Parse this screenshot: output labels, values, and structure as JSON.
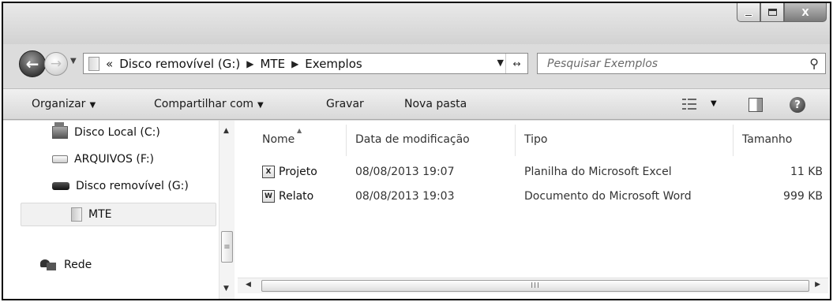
{
  "window": {
    "caption_buttons": {
      "minimize": "",
      "maximize": "",
      "close": "X"
    }
  },
  "address": {
    "chevrons": "«",
    "breadcrumbs": [
      "Disco removível (G:)",
      "MTE",
      "Exemplos"
    ],
    "separator": "▶"
  },
  "search": {
    "placeholder": "Pesquisar Exemplos"
  },
  "toolbar": {
    "organize": "Organizar",
    "share": "Compartilhar com",
    "burn": "Gravar",
    "new_folder": "Nova pasta",
    "dropdown_arrow": "▼"
  },
  "navigation_pane": {
    "items": [
      {
        "label": "Disco Local (C:)",
        "icon": "local-disk-icon"
      },
      {
        "label": "ARQUIVOS (F:)",
        "icon": "drive-icon"
      },
      {
        "label": "Disco removível (G:)",
        "icon": "removable-drive-icon"
      },
      {
        "label": "MTE",
        "icon": "folder-icon",
        "selected": true
      },
      {
        "label": "Rede",
        "icon": "network-icon"
      }
    ]
  },
  "file_list": {
    "columns": [
      "Nome",
      "Data de modificação",
      "Tipo",
      "Tamanho"
    ],
    "rows": [
      {
        "name": "Projeto",
        "date": "08/08/2013 19:07",
        "type": "Planilha do Microsoft Excel",
        "size": "11 KB",
        "icon": "excel-file-icon"
      },
      {
        "name": "Relato",
        "date": "08/08/2013 19:03",
        "type": "Documento do Microsoft Word",
        "size": "999 KB",
        "icon": "word-file-icon"
      }
    ]
  },
  "scrollbar": {
    "grip": "III",
    "vgrip": "≡"
  },
  "colors": {
    "window_frame": "#dcdcdc",
    "toolbar": "#e4e4e4",
    "content_bg": "#ffffff"
  }
}
